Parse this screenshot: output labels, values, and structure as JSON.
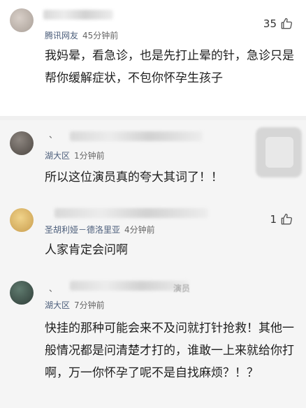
{
  "comments": [
    {
      "prefix": "",
      "location": "腾讯网友",
      "time": "45分钟前",
      "likes": "35",
      "text": "我妈晕，看急诊，也是先打止晕的针，急诊只是帮你缓解症状，不包你怀孕生孩子"
    },
    {
      "prefix": "、",
      "location": "湖大区",
      "time": "1分钟前",
      "text": "所以这位演员真的夸大其词了！！"
    },
    {
      "prefix": "",
      "location": "圣胡利娅－德洛里亚",
      "time": "4分钟前",
      "likes": "1",
      "text": "人家肯定会问啊"
    },
    {
      "prefix": "、",
      "suffix": "演员",
      "location": "湖大区",
      "time": "7分钟前",
      "text": "快挂的那种可能会来不及问就打针抢救！其他一般情况都是问清楚才打的，谁敢一上来就给你打啊，万一你怀孕了呢不是自找麻烦？！？"
    }
  ],
  "icons": {
    "like": "thumbs-up-icon"
  }
}
